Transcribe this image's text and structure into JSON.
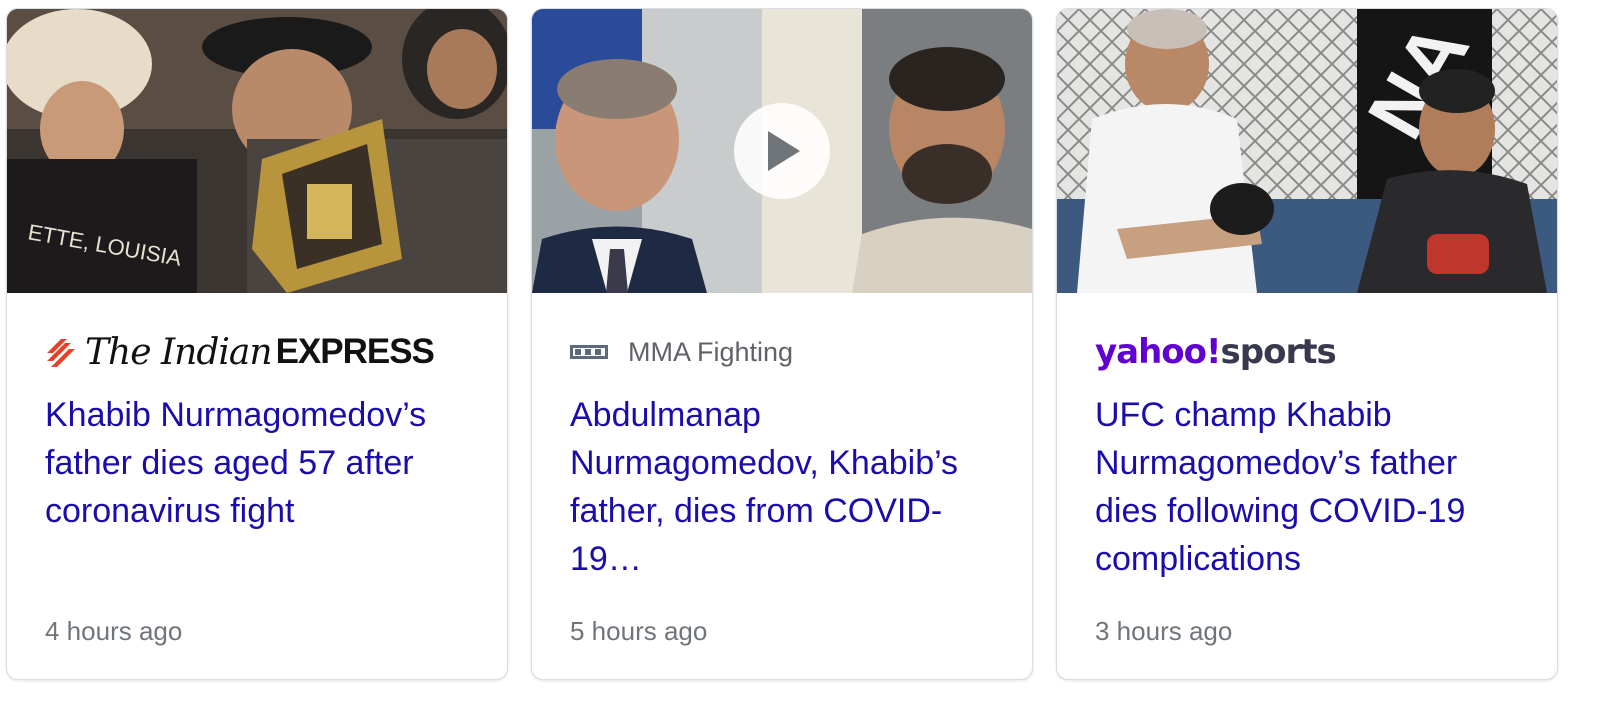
{
  "cards": [
    {
      "source": "The Indian EXPRESS",
      "source_parts": {
        "the_indian": "The Indian",
        "express": "EXPRESS"
      },
      "headline": "Khabib Nurmagomedov’s father dies aged 57 after coronavirus fight",
      "time": "4 hours ago",
      "has_video": false
    },
    {
      "source": "MMA Fighting",
      "headline": "Abdulmanap Nurmagomedov, Khabib’s father, dies from COVID-19…",
      "time": "5 hours ago",
      "has_video": true
    },
    {
      "source": "yahoo!sports",
      "source_parts": {
        "yahoo": "yahoo!",
        "sports": "sports"
      },
      "headline": "UFC champ Khabib Nurmagomedov’s father dies following COVID-19 complications",
      "time": "3 hours ago",
      "has_video": false
    }
  ],
  "colors": {
    "headline": "#1a0dab",
    "time": "#70757a",
    "source": "#5f6368",
    "yahoo_purple": "#6001d2",
    "ie_red": "#e8412a"
  },
  "icons": {
    "play": "play-icon",
    "mma_logo": "mma-fighting-logo-icon",
    "ie_logo": "indian-express-logo-icon"
  }
}
